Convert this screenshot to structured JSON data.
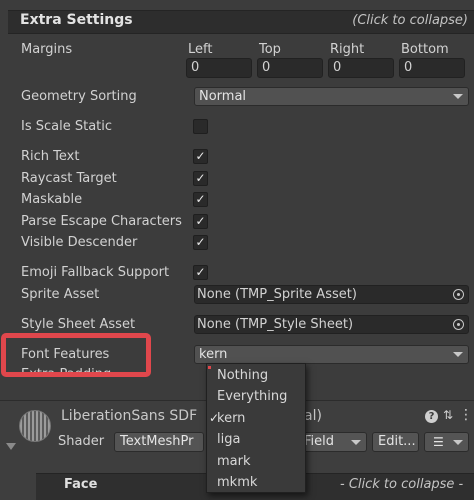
{
  "section": {
    "title": "Extra Settings",
    "collapse_hint": "(Click to collapse)"
  },
  "margins": {
    "label": "Margins",
    "columns": [
      "Left",
      "Top",
      "Right",
      "Bottom"
    ],
    "values": [
      "0",
      "0",
      "0",
      "0"
    ]
  },
  "geometry_sorting": {
    "label": "Geometry Sorting",
    "value": "Normal"
  },
  "is_scale_static": {
    "label": "Is Scale Static",
    "checked": false
  },
  "toggles": [
    {
      "label": "Rich Text",
      "checked": true,
      "mark": "✓"
    },
    {
      "label": "Raycast Target",
      "checked": true,
      "mark": "✓"
    },
    {
      "label": "Maskable",
      "checked": true,
      "mark": "✓"
    },
    {
      "label": "Parse Escape Characters",
      "checked": true,
      "mark": "✓"
    },
    {
      "label": "Visible Descender",
      "checked": true,
      "mark": "✓"
    }
  ],
  "emoji_fallback": {
    "label": "Emoji Fallback Support",
    "checked": true,
    "mark": "✓"
  },
  "sprite_asset": {
    "label": "Sprite Asset",
    "value": "None (TMP_Sprite Asset)"
  },
  "style_sheet_asset": {
    "label": "Style Sheet Asset",
    "value": "None (TMP_Style Sheet)"
  },
  "font_features": {
    "label": "Font Features",
    "value": "kern"
  },
  "extra_padding": {
    "label": "Extra Padding"
  },
  "font_features_menu": {
    "options": [
      "Nothing",
      "Everything",
      "kern",
      "liga",
      "mark",
      "mkmk"
    ],
    "selected": "kern",
    "check_mark": "✓"
  },
  "material": {
    "name_left": "LiberationSans SDF",
    "name_right": "al)",
    "shader_label": "Shader",
    "shader_value_left": "TextMeshPr",
    "shader_value_right": "Field",
    "edit_button": "Edit..."
  },
  "face": {
    "title": "Face",
    "collapse_hint": "- Click to collapse -"
  },
  "colors": {
    "highlight_red": "#e0474c",
    "panel": "#3c3c3c",
    "header": "#2d2d2d"
  }
}
